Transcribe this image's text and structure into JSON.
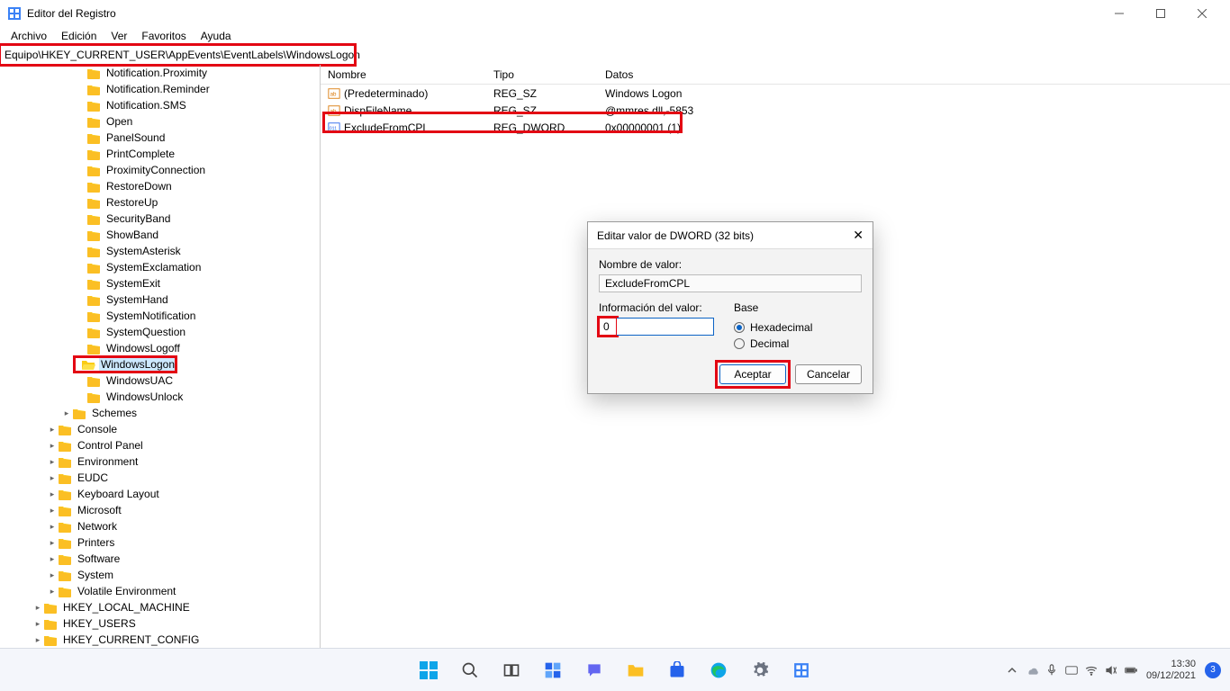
{
  "window": {
    "title": "Editor del Registro"
  },
  "menu": {
    "file": "Archivo",
    "edit": "Edición",
    "view": "Ver",
    "favorites": "Favoritos",
    "help": "Ayuda"
  },
  "address": {
    "path": "Equipo\\HKEY_CURRENT_USER\\AppEvents\\EventLabels\\WindowsLogon"
  },
  "tree": {
    "eventLabels": [
      "Notification.Proximity",
      "Notification.Reminder",
      "Notification.SMS",
      "Open",
      "PanelSound",
      "PrintComplete",
      "ProximityConnection",
      "RestoreDown",
      "RestoreUp",
      "SecurityBand",
      "ShowBand",
      "SystemAsterisk",
      "SystemExclamation",
      "SystemExit",
      "SystemHand",
      "SystemNotification",
      "SystemQuestion",
      "WindowsLogoff",
      "WindowsLogon",
      "WindowsUAC",
      "WindowsUnlock"
    ],
    "schemes": "Schemes",
    "hkcuSiblings": [
      "Console",
      "Control Panel",
      "Environment",
      "EUDC",
      "Keyboard Layout",
      "Microsoft",
      "Network",
      "Printers",
      "Software",
      "System",
      "Volatile Environment"
    ],
    "roots": {
      "hklm": "HKEY_LOCAL_MACHINE",
      "hku": "HKEY_USERS",
      "hkcc": "HKEY_CURRENT_CONFIG"
    }
  },
  "list": {
    "cols": {
      "name": "Nombre",
      "type": "Tipo",
      "data": "Datos"
    },
    "rows": [
      {
        "name": "(Predeterminado)",
        "type": "REG_SZ",
        "data": "Windows Logon",
        "icon": "sz"
      },
      {
        "name": "DispFileName",
        "type": "REG_SZ",
        "data": "@mmres.dll,-5853",
        "icon": "sz"
      },
      {
        "name": "ExcludeFromCPL",
        "type": "REG_DWORD",
        "data": "0x00000001 (1)",
        "icon": "dw"
      }
    ]
  },
  "dialog": {
    "title": "Editar valor de DWORD (32 bits)",
    "name_label": "Nombre de valor:",
    "name_value": "ExcludeFromCPL",
    "data_label": "Información del valor:",
    "data_value": "0",
    "base_label": "Base",
    "hex": "Hexadecimal",
    "dec": "Decimal",
    "ok": "Aceptar",
    "cancel": "Cancelar"
  },
  "taskbar": {
    "time": "13:30",
    "date": "09/12/2021",
    "badge": "3"
  }
}
